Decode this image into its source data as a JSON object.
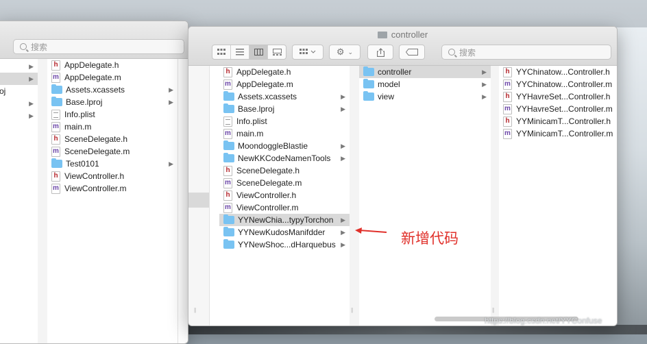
{
  "back_window": {
    "search_placeholder": "搜索",
    "sidebar_rows": [
      {
        "label": "",
        "chevron": true,
        "selected": false
      },
      {
        "label": "",
        "chevron": true,
        "selected": true
      },
      {
        "label": "oj",
        "chevron": false,
        "selected": false
      },
      {
        "label": "",
        "chevron": true,
        "selected": false
      },
      {
        "label": "",
        "chevron": true,
        "selected": false
      }
    ],
    "files": [
      {
        "icon": "h",
        "label": "AppDelegate.h",
        "chevron": false
      },
      {
        "icon": "m",
        "label": "AppDelegate.m",
        "chevron": false
      },
      {
        "icon": "folder",
        "label": "Assets.xcassets",
        "chevron": true
      },
      {
        "icon": "folder",
        "label": "Base.lproj",
        "chevron": true
      },
      {
        "icon": "plist",
        "label": "Info.plist",
        "chevron": false
      },
      {
        "icon": "m",
        "label": "main.m",
        "chevron": false
      },
      {
        "icon": "h",
        "label": "SceneDelegate.h",
        "chevron": false
      },
      {
        "icon": "m",
        "label": "SceneDelegate.m",
        "chevron": false
      },
      {
        "icon": "folder",
        "label": "Test0101",
        "chevron": true
      },
      {
        "icon": "h",
        "label": "ViewController.h",
        "chevron": false
      },
      {
        "icon": "m",
        "label": "ViewController.m",
        "chevron": false
      }
    ]
  },
  "front_window": {
    "title": "controller",
    "search_placeholder": "搜索",
    "column1": [
      {
        "icon": "h",
        "label": "AppDelegate.h",
        "chevron": false,
        "selected": false
      },
      {
        "icon": "m",
        "label": "AppDelegate.m",
        "chevron": false,
        "selected": false
      },
      {
        "icon": "folder",
        "label": "Assets.xcassets",
        "chevron": true,
        "selected": false
      },
      {
        "icon": "folder",
        "label": "Base.lproj",
        "chevron": true,
        "selected": false
      },
      {
        "icon": "plist",
        "label": "Info.plist",
        "chevron": false,
        "selected": false
      },
      {
        "icon": "m",
        "label": "main.m",
        "chevron": false,
        "selected": false
      },
      {
        "icon": "folder",
        "label": "MoondoggleBlastie",
        "chevron": true,
        "selected": false
      },
      {
        "icon": "folder",
        "label": "NewKKCodeNamenTools",
        "chevron": true,
        "selected": false
      },
      {
        "icon": "h",
        "label": "SceneDelegate.h",
        "chevron": false,
        "selected": false
      },
      {
        "icon": "m",
        "label": "SceneDelegate.m",
        "chevron": false,
        "selected": false
      },
      {
        "icon": "h",
        "label": "ViewController.h",
        "chevron": false,
        "selected": false
      },
      {
        "icon": "m",
        "label": "ViewController.m",
        "chevron": false,
        "selected": false
      },
      {
        "icon": "folder",
        "label": "YYNewChia...typyTorchon",
        "chevron": true,
        "selected": true
      },
      {
        "icon": "folder",
        "label": "YYNewKudosManifdder",
        "chevron": true,
        "selected": false
      },
      {
        "icon": "folder",
        "label": "YYNewShoc...dHarquebus",
        "chevron": true,
        "selected": false
      }
    ],
    "column2": [
      {
        "icon": "folder",
        "label": "controller",
        "chevron": true,
        "selected": true
      },
      {
        "icon": "folder",
        "label": "model",
        "chevron": true,
        "selected": false
      },
      {
        "icon": "folder",
        "label": "view",
        "chevron": true,
        "selected": false
      }
    ],
    "column3": [
      {
        "icon": "h",
        "label": "YYChinatow...Controller.h",
        "chevron": false,
        "selected": false
      },
      {
        "icon": "m",
        "label": "YYChinatow...Controller.m",
        "chevron": false,
        "selected": false
      },
      {
        "icon": "h",
        "label": "YYHavreSet...Controller.h",
        "chevron": false,
        "selected": false
      },
      {
        "icon": "m",
        "label": "YYHavreSet...Controller.m",
        "chevron": false,
        "selected": false
      },
      {
        "icon": "h",
        "label": "YYMinicamT...Controller.h",
        "chevron": false,
        "selected": false
      },
      {
        "icon": "m",
        "label": "YYMinicamT...Controller.m",
        "chevron": false,
        "selected": false
      }
    ]
  },
  "annotation": {
    "text": "新增代码",
    "color": "#e0302a"
  },
  "watermark": "https://blog.csdn.net/YYConfuse",
  "colors": {
    "folder": "#79c3f2",
    "selection": "#d9d9d9",
    "header_h": "#b5262c",
    "impl_m": "#6b46a8"
  }
}
